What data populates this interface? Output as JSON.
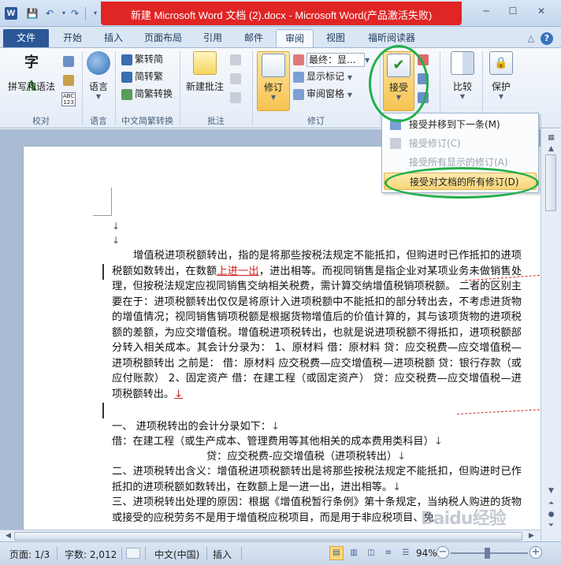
{
  "window": {
    "title": "新建 Microsoft Word 文档 (2).docx  -  Microsoft Word(产品激活失败)",
    "app_icon": "W",
    "controls": {
      "minimize": "─",
      "maximize": "☐",
      "close": "✕"
    }
  },
  "qat": {
    "save": "💾",
    "undo": "↶",
    "redo": "↷"
  },
  "tabs": {
    "file": "文件",
    "items": [
      "开始",
      "插入",
      "页面布局",
      "引用",
      "邮件",
      "审阅",
      "视图",
      "福昕阅读器"
    ],
    "active": "审阅"
  },
  "ribbon": {
    "proofing": {
      "spelling": "拼写和语法",
      "group": "校对"
    },
    "language": {
      "label": "语言",
      "group": "语言"
    },
    "chinese": {
      "to_simplified": "繁转简",
      "to_traditional": "简转繁",
      "convert": "简繁转换",
      "group": "中文简繁转换"
    },
    "comments": {
      "new": "新建批注",
      "group": "批注"
    },
    "tracking": {
      "track_changes": "修订",
      "display": "最终：显...",
      "show_markup": "显示标记",
      "reviewing_pane": "审阅窗格",
      "group": "修订"
    },
    "changes": {
      "accept": "接受"
    },
    "compare": {
      "label": "比较"
    },
    "protect": {
      "label": "保护"
    }
  },
  "accept_menu": {
    "items": [
      {
        "label": "接受并移到下一条(M)",
        "enabled": true,
        "highlighted": false
      },
      {
        "label": "接受修订(C)",
        "enabled": false,
        "highlighted": false
      },
      {
        "label": "接受所有显示的修订(A)",
        "enabled": false,
        "highlighted": false
      },
      {
        "label": "接受对文档的所有修订(D)",
        "enabled": true,
        "highlighted": true
      }
    ]
  },
  "document": {
    "para1_a": "增值税进项税额转出，指的是将那些按税法规定不能抵扣，但购进时已作抵扣的进项税额如数转出，在数额",
    "para1_ins": "上进一出",
    "para1_b": "，进出相等。而视同销售是指企业对某项业务未做销售处理，但按税法规定应视同销售交纳相关税费，需计算交纳增值税销项税额。    二者的区别主要在于：进项税额转出仅仅是将原计入进项税额中不能抵扣的部分转出去，不考虑进货物的增值情况；视同销售销项税额是根据货物增值后的价值计算的，其与该项货物的进项税额的差额，为应交增值税。增值税进项税转出，也就是说进项税额不得抵扣，进项税额部分转入相关成本。其会计分录为：    1、原材料    借：原材料    贷：应交税费—应交增值税—进项税额转出    之前是：    借：原材料    应交税费—应交增值税—进项税额    贷：银行存款（或应付账款）    2、固定资产    借：在建工程（或固定资产）    贷：应交税费—应交增值税—进项税额转出。",
    "line2": "一、  进项税转出的会计分录如下：",
    "line3": "借：在建工程（或生产成本、管理费用等其他相关的成本费用类科目）",
    "line4": "贷：应交税费-应交增值税（进项税转出）",
    "line5": "二、进项税转出含义：增值税进项税额转出是将那些按税法规定不能抵扣，但购进时已作抵扣的进项税额如数转出，在数额上是一进一出，进出相等。",
    "line6": "三、进项税转出处理的原因：根据《增值税暂行条例》第十条规定，当纳税人购进的货物或接受的应税劳务不是用于增值税应税项目，而是用于非应税项目、免"
  },
  "status": {
    "page": "页面: 1/3",
    "words": "字数: 2,012",
    "language": "中文(中国)",
    "mode": "插入",
    "zoom": "94%",
    "zoom_level": 0.94
  },
  "watermark": "Baidu经验"
}
